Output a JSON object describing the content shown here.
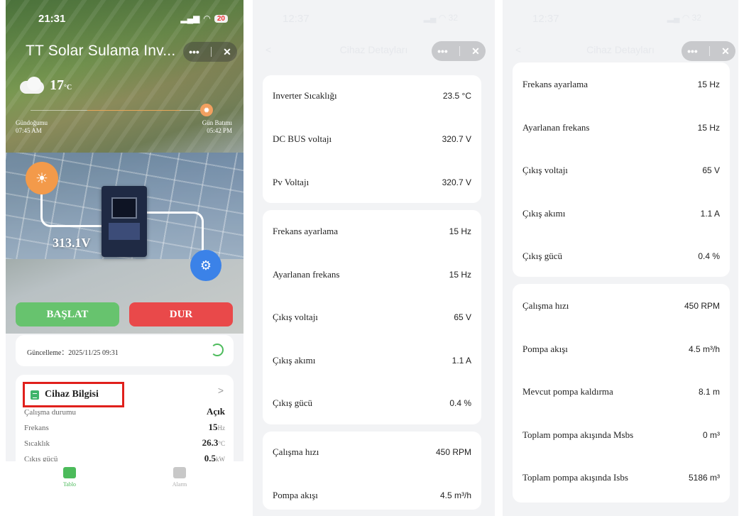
{
  "screen1": {
    "status_time": "21:31",
    "battery": "20",
    "title": "TT Solar Sulama Inv...",
    "temperature": "17",
    "temperature_unit": "°C",
    "sunrise_label": "Gündoğumu",
    "sunrise_time": "07:45 AM",
    "sunset_label": "Gün Batımı",
    "sunset_time": "05:42 PM",
    "pv_voltage_display": "313.1V",
    "start_button": "BAŞLAT",
    "stop_button": "DUR",
    "update_text": "Güncelleme：2025/11/25 09:31",
    "device_info_title": "Cihaz Bilgisi",
    "info_rows": [
      {
        "label": "Çalışma durumu",
        "value": "Açık",
        "unit": ""
      },
      {
        "label": "Frekans",
        "value": "15",
        "unit": "Hz"
      },
      {
        "label": "Sıcaklık",
        "value": "26.3",
        "unit": "°C"
      },
      {
        "label": "Çıkış gücü",
        "value": "0.5",
        "unit": "kW"
      }
    ],
    "tabs": [
      {
        "label": "Tablo"
      },
      {
        "label": "Alarm"
      }
    ],
    "colors": {
      "start": "#67c36e",
      "stop": "#e9494a",
      "highlight": "#e0201c",
      "accent": "#4cbb5b"
    }
  },
  "screen2": {
    "status_time": "12:37",
    "battery": "32",
    "title": "Cihaz Detayları",
    "cards": [
      [
        {
          "label": "Inverter Sıcaklığı",
          "value": "23.5 °C"
        },
        {
          "label": "DC BUS voltajı",
          "value": "320.7 V"
        },
        {
          "label": "Pv Voltajı",
          "value": "320.7 V"
        }
      ],
      [
        {
          "label": "Frekans ayarlama",
          "value": "15 Hz"
        },
        {
          "label": "Ayarlanan frekans",
          "value": "15 Hz"
        },
        {
          "label": "Çıkış voltajı",
          "value": "65 V"
        },
        {
          "label": "Çıkış akımı",
          "value": "1.1 A"
        },
        {
          "label": "Çıkış gücü",
          "value": "0.4 %"
        }
      ],
      [
        {
          "label": "Çalışma hızı",
          "value": "450 RPM"
        },
        {
          "label": "Pompa akışı",
          "value": "4.5 m³/h"
        }
      ]
    ]
  },
  "screen3": {
    "status_time": "12:37",
    "battery": "32",
    "title": "Cihaz Detayları",
    "cards": [
      [
        {
          "label": "Frekans ayarlama",
          "value": "15 Hz"
        },
        {
          "label": "Ayarlanan frekans",
          "value": "15 Hz"
        },
        {
          "label": "Çıkış voltajı",
          "value": "65 V"
        },
        {
          "label": "Çıkış akımı",
          "value": "1.1 A"
        },
        {
          "label": "Çıkış gücü",
          "value": "0.4 %"
        }
      ],
      [
        {
          "label": "Çalışma hızı",
          "value": "450 RPM"
        },
        {
          "label": "Pompa akışı",
          "value": "4.5 m³/h"
        },
        {
          "label": "Mevcut pompa kaldırma",
          "value": "8.1 m"
        },
        {
          "label": "Toplam pompa akışında Msbs",
          "value": "0 m³"
        },
        {
          "label": "Toplam pompa akışında Isbs",
          "value": "5186 m³"
        }
      ]
    ]
  }
}
